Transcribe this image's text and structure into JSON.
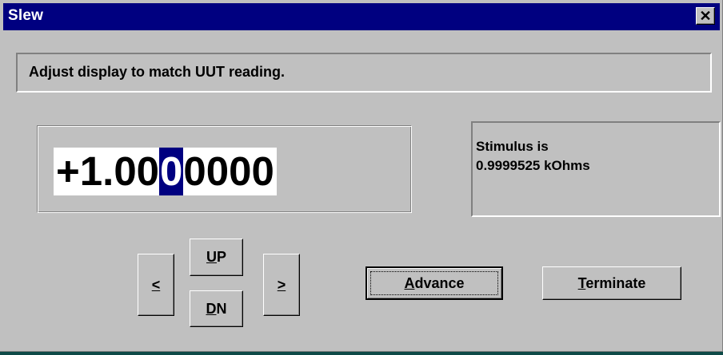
{
  "window": {
    "title": "Slew",
    "close_label": "✕"
  },
  "message": "Adjust display to match UUT reading.",
  "display": {
    "before": "+1.00",
    "selected": "0",
    "after": "0000"
  },
  "stimulus": {
    "line1": "Stimulus is",
    "line2": "0.9999525 kOhms"
  },
  "buttons": {
    "left_label": "<",
    "up_label_mnemonic": "U",
    "up_label_rest": "P",
    "dn_label_mnemonic": "D",
    "dn_label_rest": "N",
    "right_label": ">",
    "advance_mnemonic": "A",
    "advance_rest": "dvance",
    "terminate_mnemonic": "T",
    "terminate_rest": "erminate"
  }
}
